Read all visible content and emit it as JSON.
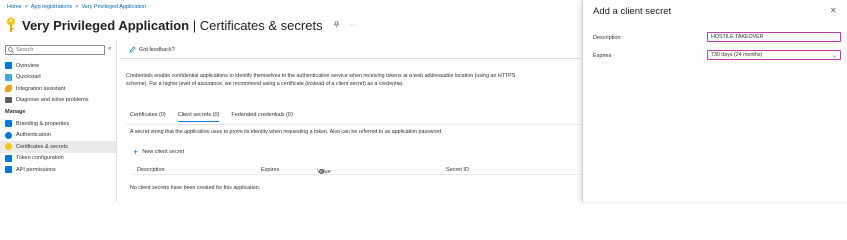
{
  "breadcrumb": [
    {
      "label": "Home"
    },
    {
      "label": "App registrations"
    },
    {
      "label": "Very Privileged Application"
    }
  ],
  "breadcrumb_separator": ">",
  "header": {
    "app_name": "Very Privileged Application",
    "page_name": "| Certificates & secrets",
    "more_label": "···"
  },
  "sidebar": {
    "search_placeholder": "Search",
    "collapse_label": "«",
    "items": [
      {
        "label": "Overview",
        "icon": "overview-icon",
        "color": "#0078d4"
      },
      {
        "label": "Quickstart",
        "icon": "quickstart-icon",
        "color": "#40a9e0"
      },
      {
        "label": "Integration assistant",
        "icon": "rocket-icon",
        "color": "#e8a317"
      },
      {
        "label": "Diagnose and solve problems",
        "icon": "wrench-icon",
        "color": "#605e5c"
      }
    ],
    "section_manage": "Manage",
    "manage_items": [
      {
        "label": "Branding & properties",
        "icon": "branding-icon",
        "color": "#0078d4"
      },
      {
        "label": "Authentication",
        "icon": "authentication-icon",
        "color": "#0078d4"
      },
      {
        "label": "Certificates & secrets",
        "icon": "key-icon",
        "color": "#f2c811",
        "selected": true
      },
      {
        "label": "Token configuration",
        "icon": "token-icon",
        "color": "#0078d4"
      },
      {
        "label": "API permissions",
        "icon": "api-icon",
        "color": "#0078d4"
      }
    ]
  },
  "main": {
    "feedback_label": "Got feedback?",
    "intro_line1": "Credentials enable confidential applications to identify themselves to the authentication service when receiving tokens at a web addressable location (using an HTTPS",
    "intro_line2": "scheme). For a higher level of assurance, we recommend using a certificate (instead of a client secret) as a credential.",
    "tabs": [
      {
        "label": "Certificates (0)",
        "active": false
      },
      {
        "label": "Client secrets (0)",
        "active": true
      },
      {
        "label": "Federated credentials (0)",
        "active": false
      }
    ],
    "tab_description": "A secret string that the application uses to prove its identity when requesting a token. Also can be referred to as application password.",
    "new_secret_label": "New client secret",
    "table_headers": {
      "description": "Description",
      "expires": "Expires",
      "value": "Value",
      "secret_id": "Secret ID"
    },
    "empty_message": "No client secrets have been created for this application."
  },
  "panel": {
    "title": "Add a client secret",
    "close_label": "✕",
    "description_label": "Description",
    "description_value": "HOSTILE TAKEOVER",
    "expires_label": "Expires",
    "expires_value": "730 days (24 months)"
  },
  "colors": {
    "accent": "#0078d4",
    "focus_border": "#c239b3",
    "key_yellow": "#f2c811"
  }
}
